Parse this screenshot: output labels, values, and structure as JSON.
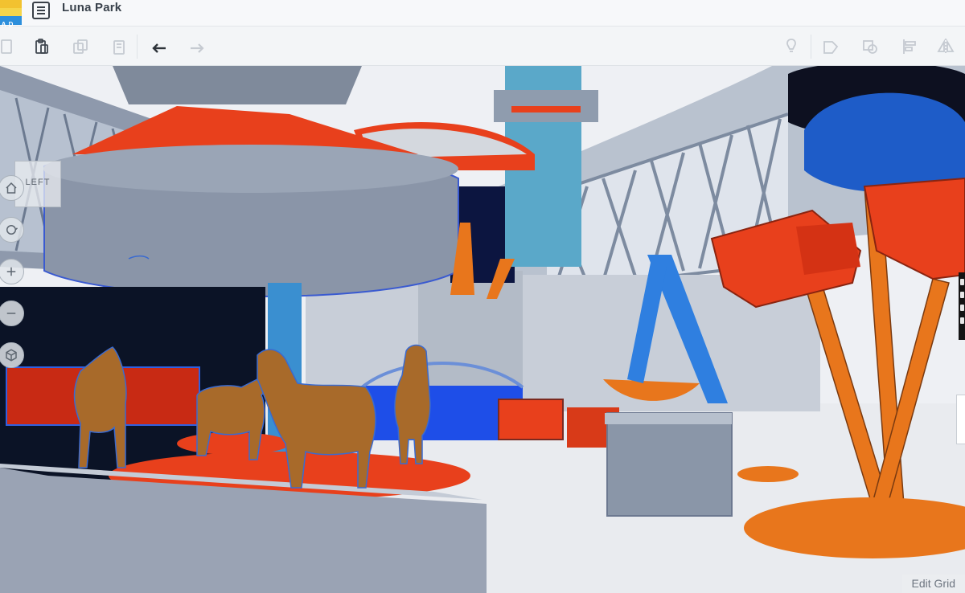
{
  "app": {
    "logo_letters": [
      "A",
      "D",
      ""
    ],
    "title": "Luna Park",
    "menu_icon": "list-menu-icon"
  },
  "toolbar": {
    "buttons": [
      {
        "name": "copy",
        "icon": "copy-icon",
        "enabled": false
      },
      {
        "name": "paste",
        "icon": "clipboard-icon",
        "enabled": true
      },
      {
        "name": "duplicate",
        "icon": "duplicate-icon",
        "enabled": false
      },
      {
        "name": "delete",
        "icon": "trash-icon",
        "enabled": false
      },
      {
        "name": "undo",
        "icon": "undo-arrow-icon",
        "enabled": true
      },
      {
        "name": "redo",
        "icon": "redo-arrow-icon",
        "enabled": false
      },
      {
        "name": "notes",
        "icon": "light-bulb-icon",
        "enabled": false
      },
      {
        "name": "group",
        "icon": "group-icon",
        "enabled": false
      },
      {
        "name": "ungroup",
        "icon": "ungroup-icon",
        "enabled": false
      },
      {
        "name": "align",
        "icon": "align-icon",
        "enabled": false
      },
      {
        "name": "mirror",
        "icon": "mirror-icon",
        "enabled": false
      }
    ]
  },
  "viewport": {
    "view_cube_label": "LEFT",
    "nav": [
      "home-icon",
      "orbit-icon",
      "zoom-in-icon",
      "zoom-out-icon",
      "view-cube-icon"
    ],
    "edit_grid_label": "Edit Grid"
  },
  "colors": {
    "accent_red": "#e8401c",
    "accent_orange": "#e8761c",
    "accent_blue": "#2f7fe0",
    "horse_brown": "#a86a2a",
    "gray_structure": "#8a95a8"
  }
}
